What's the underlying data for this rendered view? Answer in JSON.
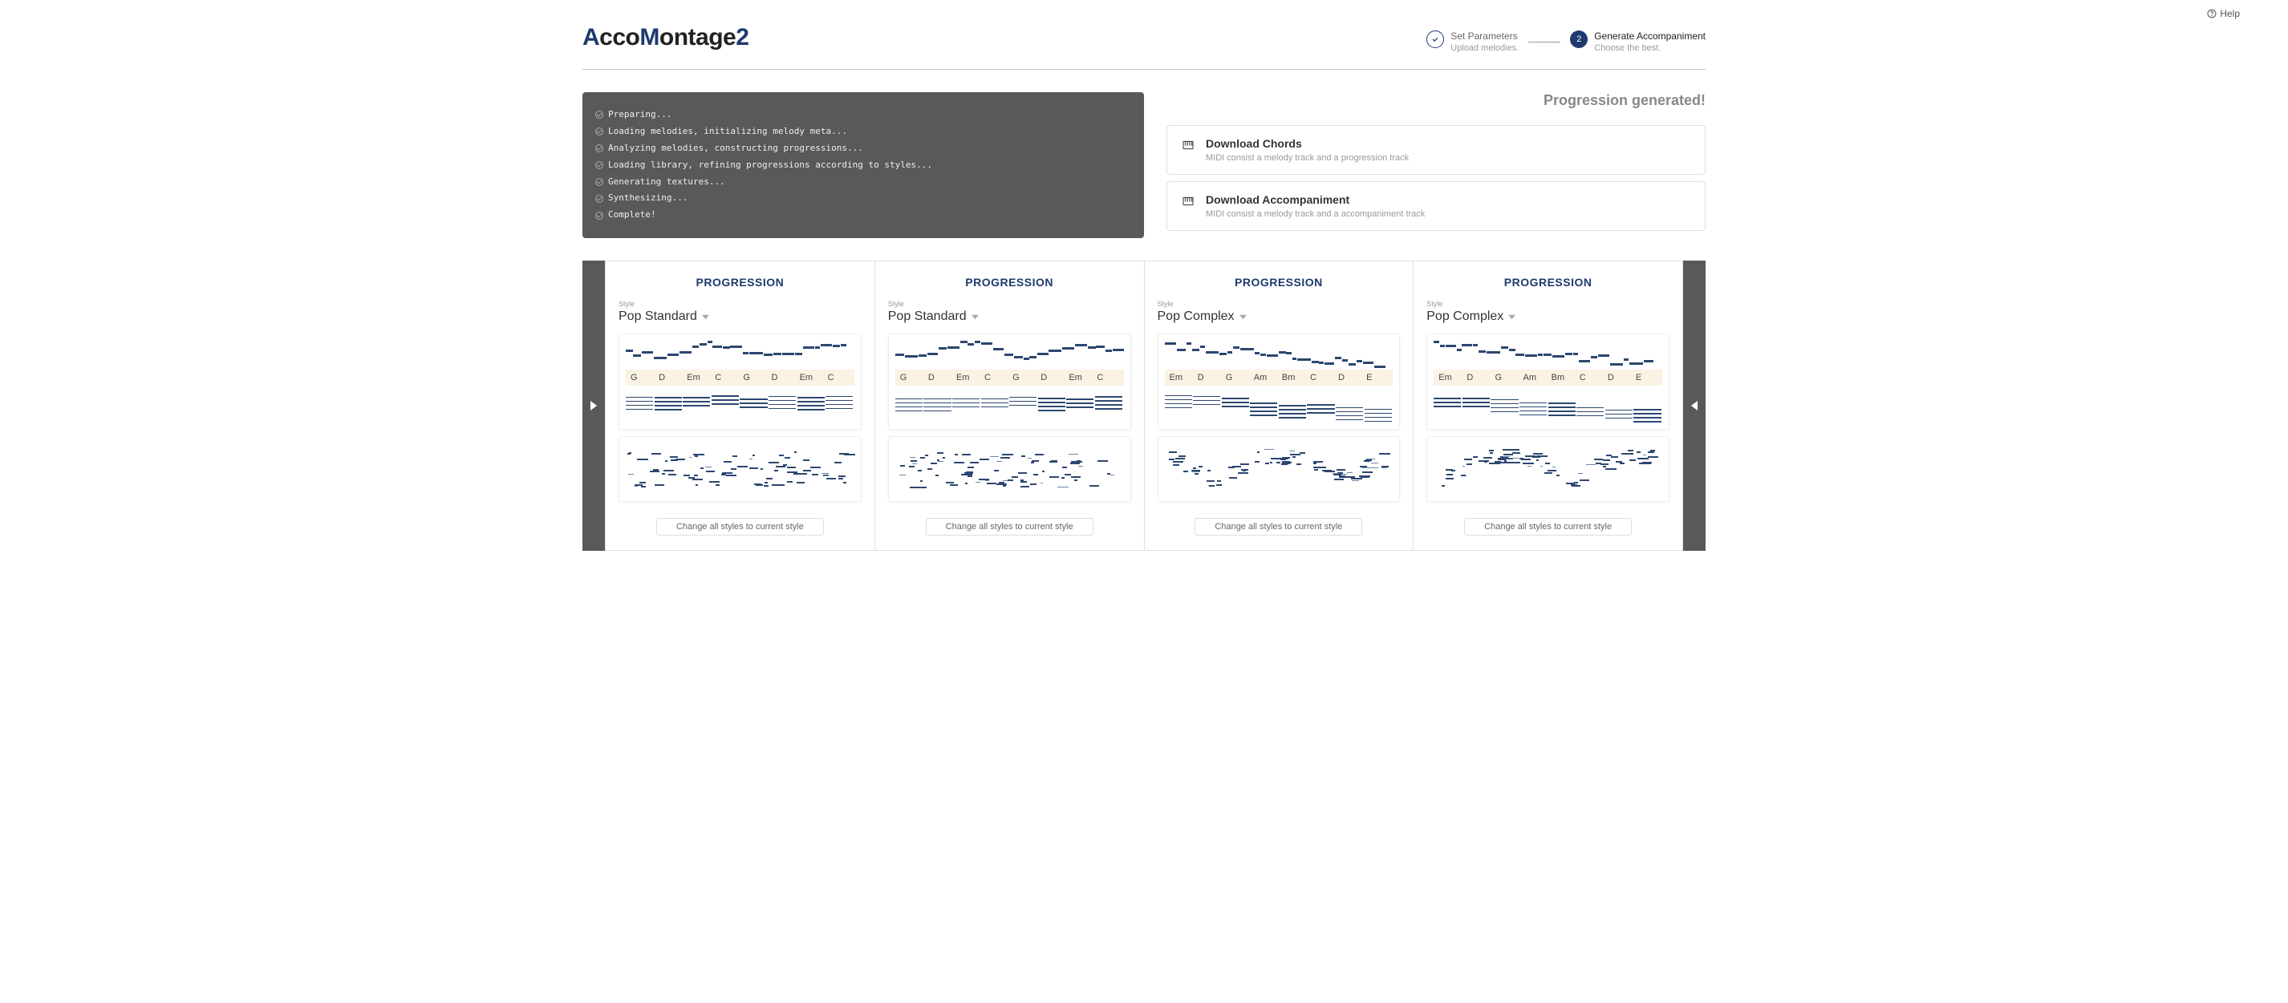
{
  "help_label": "Help",
  "logo": {
    "a": "A",
    "cco": "cco",
    "m": "M",
    "ontage": "ontage",
    "two": "2"
  },
  "steps": {
    "s1": {
      "title": "Set Parameters",
      "sub": "Upload melodies."
    },
    "s2": {
      "num": "2",
      "title": "Generate Accompaniment",
      "sub": "Choose the best."
    }
  },
  "console": [
    "Preparing...",
    "Loading melodies, initializing melody meta...",
    "Analyzing melodies, constructing progressions...",
    "Loading library, refining progressions according to styles...",
    "Generating textures...",
    "Synthesizing...",
    "Complete!"
  ],
  "generated_title": "Progression generated!",
  "downloads": [
    {
      "title": "Download Chords",
      "sub": "MIDI consist a melody track and a progression track"
    },
    {
      "title": "Download Accompaniment",
      "sub": "MIDI consist a melody track and a accompaniment track"
    }
  ],
  "card_header": "PROGRESSION",
  "style_label": "Style",
  "cards": [
    {
      "style": "Pop Standard",
      "chords": [
        "G",
        "D",
        "Em",
        "C",
        "G",
        "D",
        "Em",
        "C"
      ]
    },
    {
      "style": "Pop Standard",
      "chords": [
        "G",
        "D",
        "Em",
        "C",
        "G",
        "D",
        "Em",
        "C"
      ]
    },
    {
      "style": "Pop Complex",
      "chords": [
        "Em",
        "D",
        "G",
        "Am",
        "Bm",
        "C",
        "D",
        "E"
      ]
    },
    {
      "style": "Pop Complex",
      "chords": [
        "Em",
        "D",
        "G",
        "Am",
        "Bm",
        "C",
        "D",
        "E"
      ]
    }
  ],
  "change_label": "Change all styles to current style"
}
